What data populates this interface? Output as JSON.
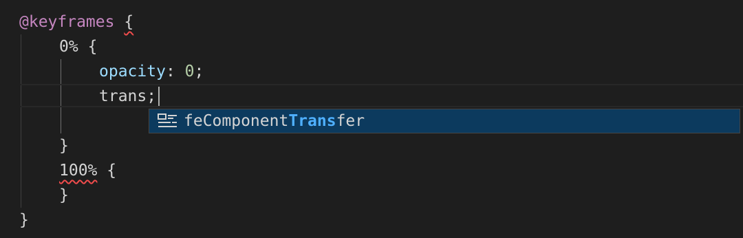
{
  "editor": {
    "lines": {
      "l1": {
        "keyword": "@keyframes",
        "brace": "{"
      },
      "l2": {
        "selector": "0%",
        "brace": "{"
      },
      "l3": {
        "property": "opacity",
        "colon": ":",
        "value": "0",
        "semi": ";"
      },
      "l4": {
        "text": "trans",
        "semi": ";"
      },
      "l6": {
        "brace": "}"
      },
      "l7": {
        "selector": "100%",
        "brace": "{"
      },
      "l8": {
        "brace": "}"
      },
      "l9": {
        "brace": "}"
      }
    }
  },
  "suggest": {
    "icon": "snippet-icon",
    "label_prefix": "feComponent",
    "label_match": "Trans",
    "label_suffix": "fer"
  },
  "colors": {
    "background": "#1e1e1e",
    "keyword": "#c586c0",
    "property": "#9cdcfe",
    "number": "#b5cea8",
    "match_highlight": "#4fb0ff",
    "error_squiggle": "#f14c4c"
  }
}
